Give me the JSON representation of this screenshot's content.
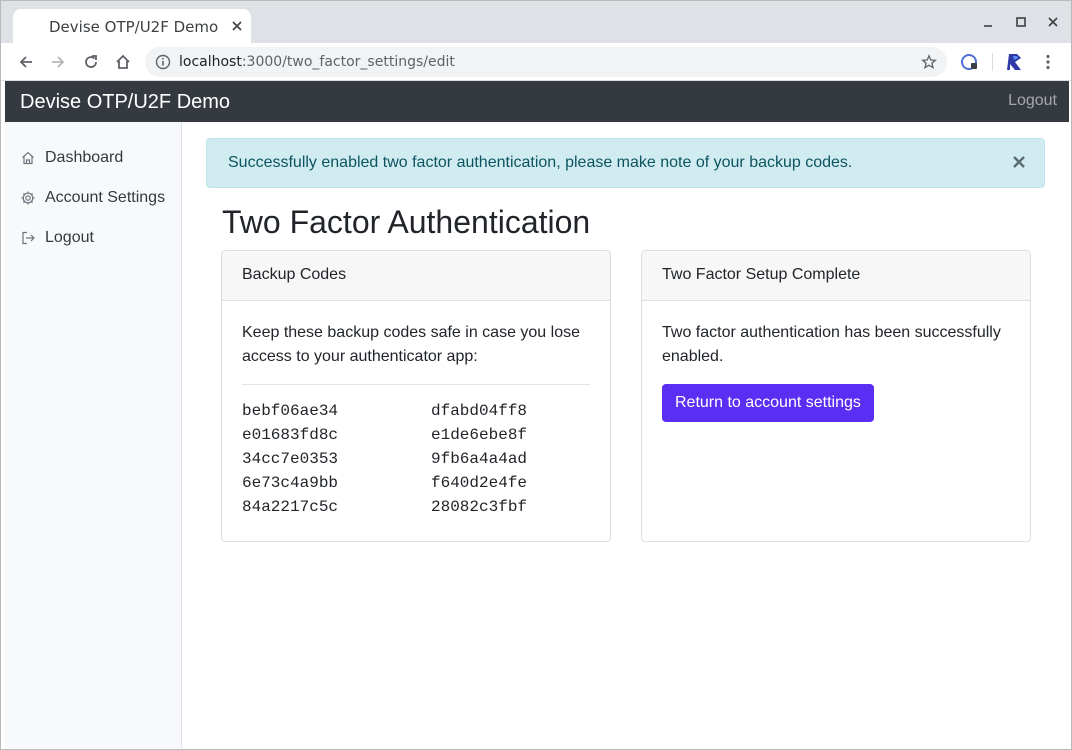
{
  "browser": {
    "tab_title": "Devise OTP/U2F Demo",
    "url_host": "localhost",
    "url_path": ":3000/two_factor_settings/edit"
  },
  "navbar": {
    "brand": "Devise OTP/U2F Demo",
    "logout": "Logout"
  },
  "sidebar": {
    "items": [
      {
        "label": "Dashboard",
        "icon": "home-icon"
      },
      {
        "label": "Account Settings",
        "icon": "gear-icon"
      },
      {
        "label": "Logout",
        "icon": "logout-icon"
      }
    ]
  },
  "alert": {
    "message": "Successfully enabled two factor authentication, please make note of your backup codes."
  },
  "page": {
    "title": "Two Factor Authentication"
  },
  "backup_card": {
    "header": "Backup Codes",
    "intro": "Keep these backup codes safe in case you lose access to your authenticator app:",
    "codes": [
      "bebf06ae34",
      "dfabd04ff8",
      "e01683fd8c",
      "e1de6ebe8f",
      "34cc7e0353",
      "9fb6a4a4ad",
      "6e73c4a9bb",
      "f640d2e4fe",
      "84a2217c5c",
      "28082c3fbf"
    ]
  },
  "complete_card": {
    "header": "Two Factor Setup Complete",
    "text": "Two factor authentication has been successfully enabled.",
    "button": "Return to account settings"
  },
  "colors": {
    "navbar_bg": "#343a40",
    "alert_bg": "#d1ecf1",
    "alert_text": "#0c5460",
    "primary_button": "#5a2ff3"
  }
}
